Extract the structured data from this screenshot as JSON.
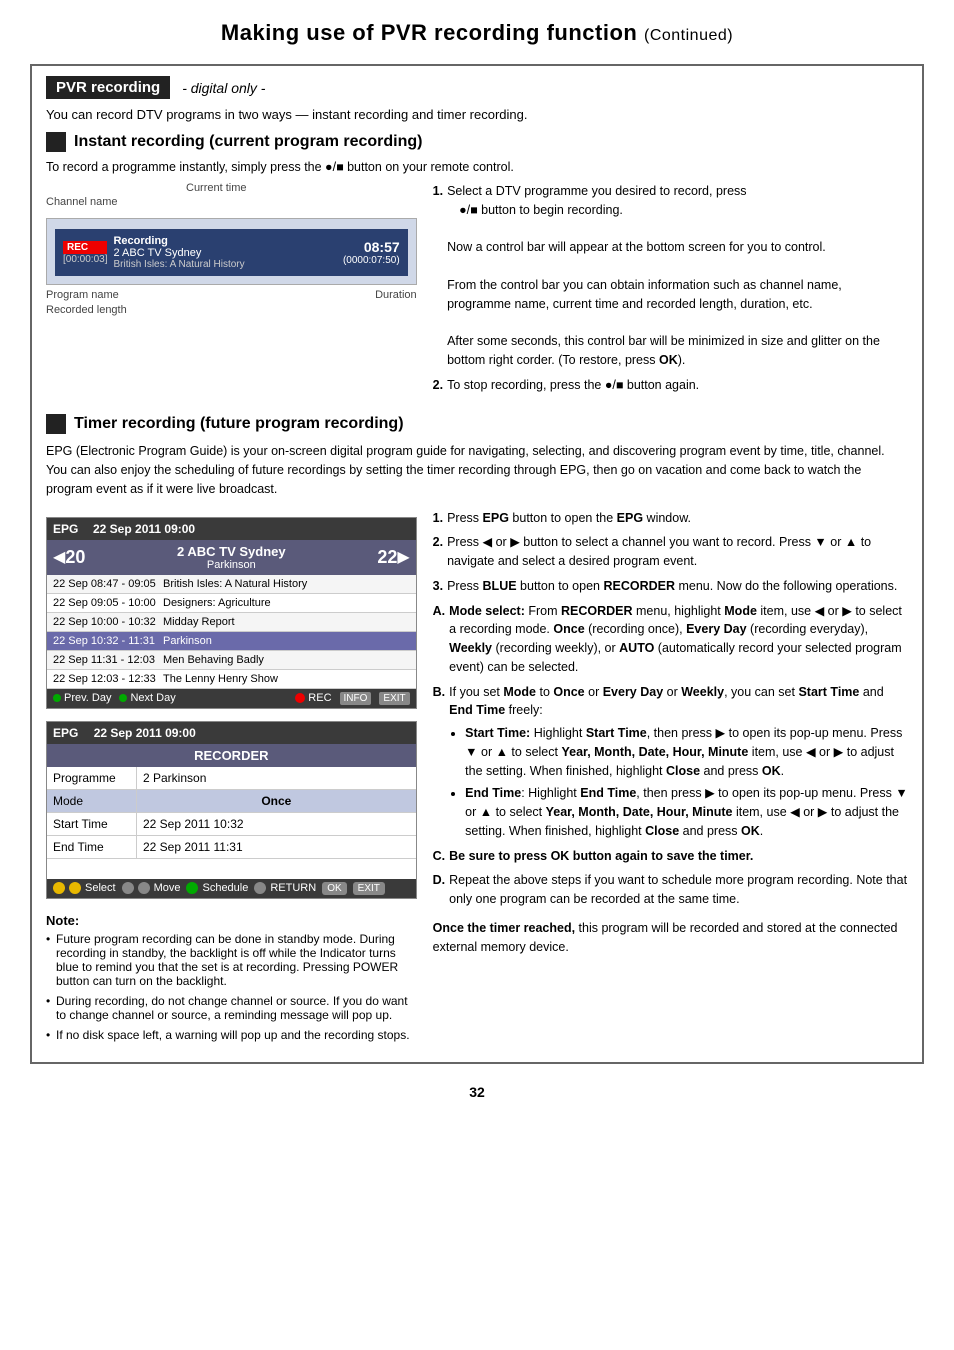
{
  "page": {
    "title": "Making use of PVR recording function",
    "continued": "(Continued)",
    "page_number": "32"
  },
  "pvr_section": {
    "label": "PVR recording",
    "subtitle": "- digital only -",
    "intro": "You can record DTV programs in two ways — instant recording and timer recording."
  },
  "instant_recording": {
    "heading": "Instant recording (current program recording)",
    "description": "To record a programme instantly, simply press the ●/■ button on your remote control.",
    "diagram": {
      "channel_name_label": "Channel name",
      "current_time_label": "Current time",
      "program_name_label": "Program name",
      "duration_label": "Duration",
      "recorded_length_label": "Recorded length",
      "rec_label": "REC",
      "recording_label": "Recording",
      "channel": "2 ABC TV Sydney",
      "program": "British Isles: A Natural History",
      "time": "08:57",
      "recorded": "[00:00:03]",
      "duration_value": "(0000:07:50)"
    },
    "steps": [
      {
        "num": "1.",
        "text": "Select a DTV programme you desired to record, press",
        "sub": "●/■ button to begin recording.",
        "sub2": "Now a control bar will appear at the bottom screen for you to control.",
        "sub3": "From the control bar you can obtain information such as channel name, programme name, current time and recorded length, duration, etc.",
        "sub4": "After some seconds, this control bar will be minimized in size and glitter on the bottom right corder. (To restore, press OK)."
      },
      {
        "num": "2.",
        "text": "To stop recording, press the ●/■ button again."
      }
    ]
  },
  "timer_recording": {
    "heading": "Timer recording (future program recording)",
    "description": "EPG (Electronic Program Guide) is your on-screen digital program guide for navigating, selecting, and discovering program event by time, title, channel. You can also enjoy the scheduling of future recordings by setting the timer recording through EPG, then go on vacation and come back to watch the program event as if it were live broadcast.",
    "epg": {
      "header_label": "EPG",
      "header_date": "22 Sep 2011   09:00",
      "channel_num_left": "20",
      "channel_num_right": "22",
      "channel_name": "ABC  TV Sydney",
      "channel_sub": "Parkinson",
      "programs": [
        {
          "time": "22 Sep  08:47 - 09:05",
          "title": "British Isles: A Natural History",
          "highlighted": false
        },
        {
          "time": "22 Sep  09:05 - 10:00",
          "title": "Designers: Agriculture",
          "highlighted": false
        },
        {
          "time": "22 Sep  10:00 - 10:32",
          "title": "Midday Report",
          "highlighted": false
        },
        {
          "time": "22 Sep  10:32 - 11:31",
          "title": "Parkinson",
          "highlighted": true
        },
        {
          "time": "22 Sep  11:31 - 12:03",
          "title": "Men Behaving Badly",
          "highlighted": false
        },
        {
          "time": "22 Sep  12:03 - 12:33",
          "title": "The Lenny Henry Show",
          "highlighted": false
        }
      ],
      "footer": {
        "prev_day": "Prev. Day",
        "next_day": "Next Day",
        "rec": "REC",
        "info": "INFO",
        "exit": "EXIT"
      }
    },
    "recorder": {
      "header_label": "EPG",
      "header_date": "22 Sep 2011   09:00",
      "title": "RECORDER",
      "programme_label": "Programme",
      "programme_value": "2 Parkinson",
      "mode_label": "Mode",
      "mode_value": "Once",
      "start_time_label": "Start Time",
      "start_time_value": "22 Sep 2011   10:32",
      "end_time_label": "End Time",
      "end_time_value": "22 Sep 2011   11:31",
      "footer_select": "Select",
      "footer_move": "Move",
      "footer_schedule": "Schedule",
      "footer_return": "RETURN",
      "footer_ok": "OK",
      "footer_exit": "EXIT"
    },
    "steps": [
      {
        "num": "1.",
        "text": "Press EPG button to open the EPG window."
      },
      {
        "num": "2.",
        "text": "Press ◄ or ► button to select a channel you want to record. Press ▼ or ▲ to navigate and select a desired program event."
      },
      {
        "num": "3.",
        "text": "Press BLUE button to open RECORDER menu. Now do the following operations."
      },
      {
        "label": "A.",
        "text": "Mode select: From RECORDER menu, highlight Mode item, use ◄ or ► to select a recording mode. Once (recording once), Every Day (recording everyday), Weekly (recording weekly), or AUTO (automatically record your selected program event) can be selected."
      },
      {
        "label": "B.",
        "text": "If you set Mode to Once or Every Day or Weekly, you can set Start Time and End Time freely:",
        "sub_items": [
          "Start Time: Highlight Start Time, then press ► to open its pop-up menu. Press ▼ or ▲ to select Year, Month, Date, Hour, Minute item, use ◄ or ► to adjust the setting. When finished, highlight Close and press OK.",
          "End Time: Highlight End Time, then press ► to open its pop-up menu. Press ▼ or ▲ to select Year, Month, Date, Hour, Minute item, use ◄ or ► to adjust the setting. When finished, highlight Close and press OK."
        ]
      },
      {
        "label": "C.",
        "text": "Be sure to press OK button again to save the timer."
      },
      {
        "label": "D.",
        "text": "Repeat the above steps if you want to schedule more program recording. Note that only one program can be recorded at the same time."
      }
    ],
    "final_note": "Once the timer reached, this program will be recorded and stored at the connected external memory device."
  },
  "note_section": {
    "label": "Note:",
    "items": [
      "Future program recording can be done in standby mode. During recording in standby, the backlight is off while the Indicator turns blue to remind you that the set is at recording. Pressing POWER button can turn on the backlight.",
      "During recording, do not change channel or source. If you do want to change channel or source, a reminding message will pop up.",
      "If no disk space left, a warning will pop up and the recording stops."
    ]
  }
}
